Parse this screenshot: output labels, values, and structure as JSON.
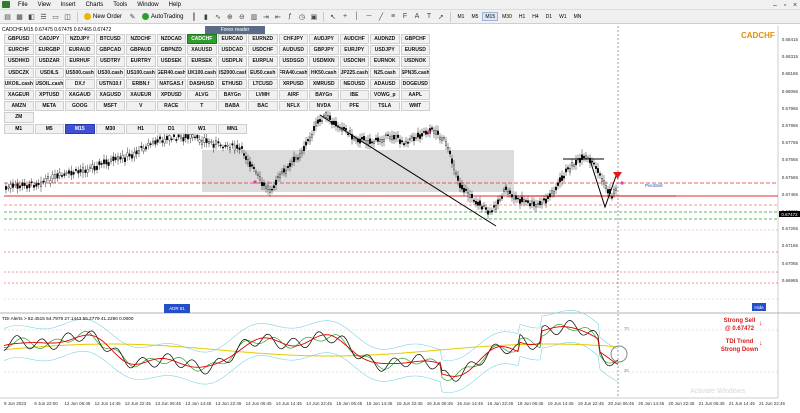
{
  "window": {
    "menu": [
      "File",
      "View",
      "Insert",
      "Charts",
      "Tools",
      "Window",
      "Help"
    ],
    "controls": [
      "–",
      "▫",
      "×"
    ]
  },
  "toolbar": {
    "new_order": "New Order",
    "auto_trading": "AutoTrading",
    "timeframes": [
      "M1",
      "M5",
      "M15",
      "M30",
      "H1",
      "H4",
      "D1",
      "W1",
      "MN"
    ],
    "active_timeframe": "M15"
  },
  "chart": {
    "title": "CADCHF,M15 0.67475 0.67475 0.67465 0.67472",
    "symbol_tag": "CADCHF",
    "panel_header": "Forex reader",
    "symbols": [
      "GBPUSD",
      "CADJPY",
      "NZDJPY",
      "BTCUSD",
      "NZDCHF",
      "NZDCAD",
      "CADCHF",
      "EURCAD",
      "EURNZD",
      "CHFJPY",
      "AUDJPY",
      "AUDCHF",
      "AUDNZD",
      "GBPCHF",
      "EURCHF",
      "EURGBP",
      "EURAUD",
      "GBPCAD",
      "GBPAUD",
      "GBPNZD",
      "XAUUSD",
      "USDCAD",
      "USDCHF",
      "AUDUSD",
      "GBPJPY",
      "EURJPY",
      "USDJPY",
      "EURUSD",
      "USDHKD",
      "USDZAR",
      "EURHUF",
      "USDTRY",
      "EURTRY",
      "USDSEK",
      "EURSEK",
      "USDPLN",
      "EURPLN",
      "USDSGD",
      "USDMXN",
      "USDCNH",
      "EURNOK",
      "USDNOK",
      "USDCZK",
      "USDILS",
      "US500.cash",
      "US30.cash",
      "US100.cash",
      "GER40.cash",
      "UK100.cash",
      "US2000.cash",
      "EU50.cash",
      "FRA40.cash",
      "HK50.cash",
      "JP225.cash",
      "N25.cash",
      "SPN35.cash",
      "UKOIL.cash",
      "USOIL.cash",
      "DX.f",
      "USTN10.f",
      "ERBN.f",
      "NATGAS.f",
      "DASHUSD",
      "ETHUSD",
      "LTCUSD",
      "XRPUSD",
      "XMRUSD",
      "NEOUSD",
      "ADAUSD",
      "DOGEUSD",
      "XAGEUR",
      "XPTUSD",
      "XAGAUD",
      "XAGUSD",
      "XAUEUR",
      "XPDUSD",
      "ALVG",
      "BAYGn",
      "LVMH",
      "AIRF",
      "BAYGn",
      "IBE",
      "VOWG_p",
      "AAPL",
      "AMZN",
      "META",
      "GOOG",
      "MSFT",
      "V",
      "RACE",
      "T",
      "BABA",
      "BAC",
      "NFLX",
      "NVDA",
      "PFE",
      "TSLA",
      "WMT",
      "ZM"
    ],
    "highlight_symbol": "CADCHF",
    "tf_buttons": [
      "M1",
      "M5",
      "M15",
      "M30",
      "H1",
      "D1",
      "W1",
      "MN1"
    ],
    "tf_active": "M15",
    "price_labels": [
      {
        "v": "0.68415"
      },
      {
        "v": "0.68315"
      },
      {
        "v": "0.68165"
      },
      {
        "v": "0.68065"
      },
      {
        "v": "0.67965"
      },
      {
        "v": "0.67865"
      },
      {
        "v": "0.67765"
      },
      {
        "v": "0.67665"
      },
      {
        "v": "0.67565"
      },
      {
        "v": "0.67465"
      },
      {
        "v": "0.67365"
      },
      {
        "v": "0.67265"
      },
      {
        "v": "0.67165"
      },
      {
        "v": "0.67065"
      },
      {
        "v": "0.66965"
      }
    ],
    "current_price": "0.67472",
    "time_labels": [
      "9 Jun 2023",
      "9 Jun 22:00",
      "12 Jun 06:45",
      "12 Jun 14:45",
      "12 Jun 22:45",
      "13 Jun 06:45",
      "13 Jun 14:45",
      "13 Jun 22:45",
      "14 Jun 06:45",
      "14 Jun 14:45",
      "14 Jun 22:45",
      "15 Jun 06:45",
      "15 Jun 14:45",
      "15 Jun 22:45",
      "16 Jun 06:45",
      "16 Jun 14:45",
      "16 Jun 22:45",
      "19 Jun 06:45",
      "19 Jun 14:45",
      "19 Jun 22:45",
      "20 Jun 06:45",
      "20 Jun 14:45",
      "20 Jun 22:45",
      "21 Jun 06:45",
      "21 Jun 14:45",
      "21 Jun 22:45"
    ],
    "hide_label": "Hide",
    "adr_label": "ADR 81",
    "pivot_label": "PivotSell"
  },
  "indicator": {
    "title": "TDI Alerts > 82.4515 54.7979 27.1443 55.2779 41.2290 0.0000",
    "levels": [
      "70",
      "30"
    ],
    "alert_line1": "Strong Sell",
    "alert_line2": "@ 0.67472",
    "alert_line3": "TDI Trend",
    "alert_line4": "Strong Down",
    "watermark": "Activate Windows"
  },
  "colors": {
    "candle": "#000000",
    "zone": "#d3d3d3",
    "red_line": "#e03030",
    "green_line": "#2aa12a",
    "tdi_red": "#e00000",
    "tdi_yellow": "#e6c800",
    "tdi_green": "#2fa12f",
    "tdi_band": "#7fd4e6",
    "alert": "#e01818"
  }
}
